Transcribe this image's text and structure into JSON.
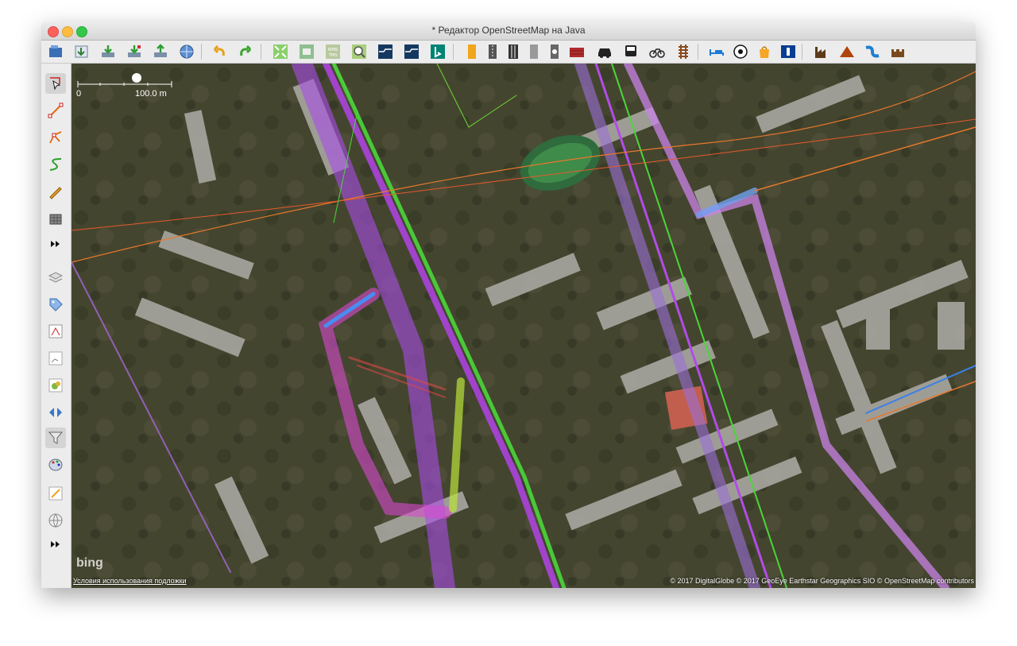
{
  "window": {
    "title": "* Редактор OpenStreetMap на Java"
  },
  "toolbar": {
    "icons": [
      "open-file-icon",
      "download-icon",
      "download-object-icon",
      "download-along-icon",
      "upload-icon",
      "globe-upload-icon",
      "undo-icon",
      "redo-icon",
      "zoom-to-data-icon",
      "print-icon",
      "wms-icon",
      "search-icon",
      "preset-icon",
      "preset-icon",
      "bing-icon",
      "road-icon",
      "road-icon",
      "road-icon",
      "road-icon",
      "railway-icon",
      "building-icon",
      "car-icon",
      "bus-icon",
      "bicycle-icon",
      "railway-track-icon",
      "bed-icon",
      "football-icon",
      "shop-icon",
      "info-icon",
      "factory-icon",
      "peak-icon",
      "waterway-icon",
      "castle-icon"
    ]
  },
  "left_toolbar": {
    "icons": [
      "select-icon",
      "draw-line-icon",
      "draw-node-icon",
      "improve-way-icon",
      "pencil-icon",
      "building-tool-icon",
      "more-icon",
      "layers-icon",
      "tags-icon",
      "relation-icon",
      "selection-list-icon",
      "image-icon",
      "map-paint-icon",
      "filter-icon",
      "palette-icon",
      "validation-icon",
      "globe-icon",
      "more-icon"
    ]
  },
  "map": {
    "scale_zero": "0",
    "scale_label": "100.0 m",
    "terms_link": "Условия использования подложки",
    "attribution": "© 2017 DigitalGlobe © 2017 GeoEye Earthstar Geographics SIO © OpenStreetMap contributors",
    "bing_logo": "bing"
  }
}
